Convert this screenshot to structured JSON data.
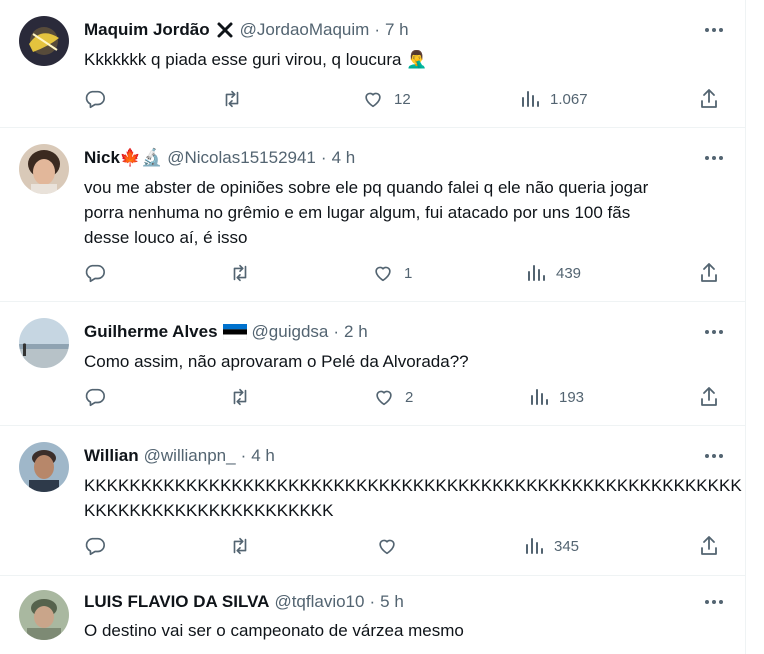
{
  "tweets": [
    {
      "name": "Maquim Jordão",
      "badge_icon": "x-mark-badge",
      "handle": "@JordaoMaquim",
      "separator": "·",
      "time": "7 h",
      "text": "Kkkkkkk q piada esse guri virou, q loucura 🤦‍♂️",
      "likes": "12",
      "views": "1.067",
      "avatar_colors": [
        "#2a2a3a",
        "#f4d03f"
      ]
    },
    {
      "name": "Nick🍁🔬",
      "handle": "@Nicolas15152941",
      "separator": "·",
      "time": "4 h",
      "text": "vou me abster de opiniões sobre ele pq quando falei q ele não queria jogar\nporra nenhuma no grêmio e em lugar algum, fui atacado por uns 100 fãs\ndesse louco aí, é isso",
      "likes": "1",
      "views": "439",
      "avatar_colors": [
        "#d9c9b8",
        "#3b2a20"
      ]
    },
    {
      "name": "Guilherme Alves",
      "badge_icon": "estonia-flag",
      "handle": "@guigdsa",
      "separator": "·",
      "time": "2 h",
      "text": "Como assim, não aprovaram o Pelé da Alvorada??",
      "likes": "2",
      "views": "193",
      "avatar_colors": [
        "#c6d6e2",
        "#8fa3b2"
      ]
    },
    {
      "name": "Willian",
      "handle": "@willianpn_",
      "separator": "·",
      "time": "4 h",
      "text": "KKKKKKKKKKKKKKKKKKKKKKKKKKKKKKKKKKKKKKKKKKKKKKKKKKKKKKKKKK\nKKKKKKKKKKKKKKKKKKKKKK",
      "likes": "",
      "views": "345",
      "avatar_colors": [
        "#9fb7c9",
        "#3b2e2a"
      ]
    },
    {
      "name": "LUIS FLAVIO DA SILVA",
      "handle": "@tqflavio10",
      "separator": "·",
      "time": "5 h",
      "text": "O destino vai ser o campeonato de várzea mesmo",
      "avatar_colors": [
        "#a9b8a0",
        "#56634d"
      ]
    }
  ],
  "icons": {
    "more": "more-horizontal-icon",
    "reply": "reply-icon",
    "retweet": "retweet-icon",
    "like": "like-icon",
    "views": "views-icon",
    "share": "share-icon"
  },
  "colors": {
    "text": "#0f1419",
    "secondary": "#536471",
    "divider": "#eff3f4"
  }
}
